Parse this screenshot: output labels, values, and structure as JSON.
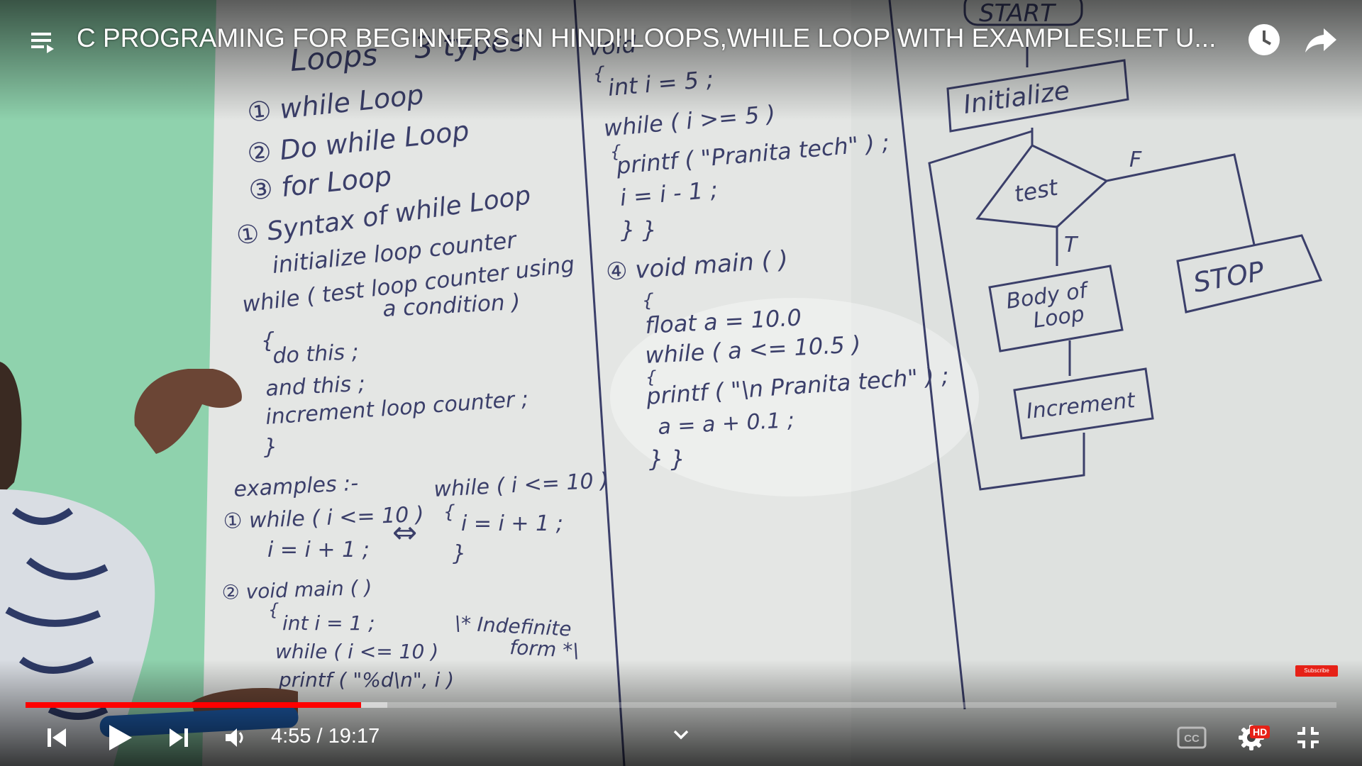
{
  "video": {
    "title": "C PROGRAMING FOR BEGINNERS IN HINDI!LOOPS,WHILE LOOP WITH EXAMPLES!LET U...",
    "current_time": "4:55",
    "separator": " / ",
    "duration": "19:17",
    "played_fraction": 0.256,
    "buffered_fraction": 0.276
  },
  "overlay": {
    "subscribe_label": "Subscribe",
    "hd_badge": "HD"
  },
  "icons": {
    "playlist": "playlist-icon",
    "watch_later": "clock-icon",
    "share": "share-icon",
    "previous": "skip-previous-icon",
    "play": "play-icon",
    "next": "skip-next-icon",
    "volume": "volume-icon",
    "chevron": "chevron-down-icon",
    "captions": "cc-icon",
    "settings": "gear-icon",
    "exit_fullscreen": "exit-fullscreen-icon"
  },
  "colors": {
    "progress_played": "#ff0000",
    "whiteboard": "#e4e6e4",
    "wall": "#8fd2ad",
    "ink": "#3b3f6a"
  },
  "whiteboard": {
    "col1": {
      "heading": "Loops",
      "heading2": "3 types",
      "items": [
        "① while Loop",
        "② Do while Loop",
        "③ for Loop"
      ],
      "syntax_heading": "① Syntax of while Loop",
      "syntax_lines": [
        "initialize loop counter",
        "while ( test loop counter using",
        "a condition )",
        "{",
        "do this ;",
        "and this ;",
        "increment loop counter ;",
        "}"
      ],
      "examples_heading": "examples :-",
      "ex1_lines": [
        "① while ( i <= 10 )",
        "i = i + 1 ;"
      ],
      "equiv_symbol": "⇔",
      "ex1_alt_lines": [
        "while ( i <= 10 )",
        "{",
        "i = i + 1 ;",
        "}"
      ],
      "ex2_lines": [
        "② void main ( )",
        "{",
        "int i = 1 ;",
        "while ( i <= 10 )",
        "printf ( \"%d\\n\", i )",
        "}"
      ],
      "ex2_note": [
        "\\* Indefinite",
        "form *\\"
      ]
    },
    "col2": {
      "top_lines": [
        "void",
        "{",
        "int i = 5 ;",
        "while ( i >= 5 )",
        "{",
        "printf ( \"Pranita tech\" ) ;",
        "i = i - 1 ;",
        "} }"
      ],
      "ex4_lines": [
        "④ void main ( )",
        "{",
        "float a = 10.0",
        "while ( a <= 10.5 )",
        "{",
        "printf ( \"\\n Pranita tech\" ) ;",
        "a = a + 0.1 ;",
        "} }"
      ]
    },
    "flowchart": {
      "start": "START",
      "initialize": "Initialize",
      "test": "test",
      "false_label": "F",
      "true_label": "T",
      "body": "Body of",
      "body2": "Loop",
      "increment": "Increment",
      "stop": "STOP"
    }
  }
}
